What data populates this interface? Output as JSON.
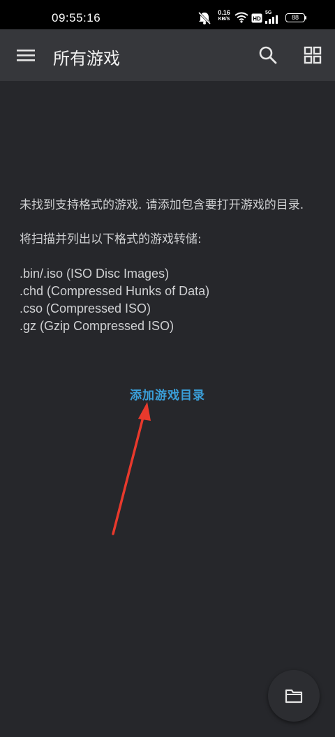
{
  "status_bar": {
    "time": "09:55:16",
    "network_speed": "0.16",
    "network_speed_unit": "KB/S",
    "signal_label": "5G",
    "battery": "88"
  },
  "app_bar": {
    "title": "所有游戏",
    "icons": [
      "menu-icon",
      "search-icon",
      "grid-view-icon"
    ]
  },
  "empty_state": {
    "message": "未找到支持格式的游戏. 请添加包含要打开游戏的目录.",
    "scan_info": "将扫描并列出以下格式的游戏转储:",
    "formats": [
      ".bin/.iso (ISO Disc Images)",
      ".chd (Compressed Hunks of Data)",
      ".cso (Compressed ISO)",
      ".gz (Gzip Compressed ISO)"
    ],
    "add_directory_label": "添加游戏目录"
  },
  "fab": {
    "icon": "folder-icon"
  },
  "colors": {
    "background": "#26272b",
    "app_bar": "#36373b",
    "accent": "#3a9fd9",
    "annotation_arrow": "#e8392c"
  }
}
